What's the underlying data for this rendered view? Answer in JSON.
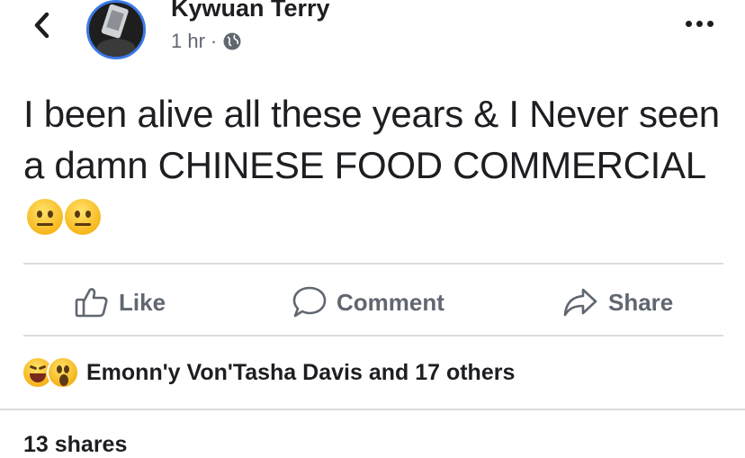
{
  "header": {
    "back_icon": "chevron-left-icon",
    "author_name": "Kywuan Terry",
    "timestamp": "1 hr",
    "separator": "·",
    "privacy_icon": "globe-icon",
    "more_icon": "more-dots-icon"
  },
  "post": {
    "text": "I been alive all these years & I Never seen a damn CHINESE FOOD COMMERCIAL",
    "emojis": [
      "neutral-face-emoji",
      "neutral-face-emoji"
    ]
  },
  "actions": {
    "like_label": "Like",
    "comment_label": "Comment",
    "share_label": "Share"
  },
  "reactions": {
    "icons": [
      "haha-reaction-icon",
      "wow-reaction-icon"
    ],
    "summary": "Emonn'y Von'Tasha Davis and 17 others"
  },
  "footer": {
    "shares": "13 shares"
  },
  "colors": {
    "avatar_ring": "#3b78e7",
    "secondary_text": "#606770",
    "divider": "#dadde1"
  }
}
